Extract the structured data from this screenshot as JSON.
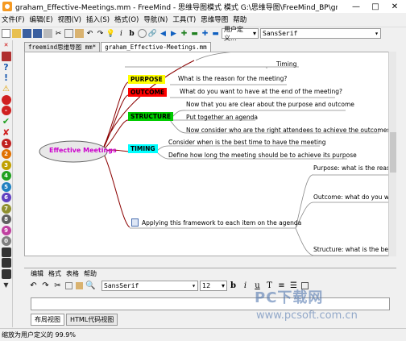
{
  "window": {
    "title": "graham_Effective-Meetings.mm - FreeMind - 思维导图模式 模式 G:\\思维导图\\FreeMind_BP\\graha...",
    "min_glyph": "—",
    "max_glyph": "□",
    "close_glyph": "✕"
  },
  "menu": [
    "文件(F)",
    "编辑(E)",
    "视图(V)",
    "插入(S)",
    "格式(O)",
    "导航(N)",
    "工具(T)",
    "思维导图",
    "帮助"
  ],
  "toolbar": {
    "zoom_value": "用户定义...",
    "font_value": "SansSerif"
  },
  "tabs": [
    "freemind思维导图 mm*",
    "graham_Effective-Meetings.mm"
  ],
  "mindmap": {
    "root": "Effective Meetings",
    "top_child": "Timing",
    "purpose": {
      "label": "PURPOSE",
      "text": "What is the reason for the meeting?"
    },
    "outcome": {
      "label": "OUTCOME",
      "text": "What do you want to have at the end of the meeting?"
    },
    "structure": {
      "label": "STRUCTURE",
      "items": [
        "Now that you are clear about the purpose and outcome",
        "Put together an agenda",
        "Now consider who are the right attendees to achieve the outcomes"
      ]
    },
    "timing": {
      "label": "TIMING",
      "items": [
        "Consider when is the best time to have the meeting",
        "Define how long the meeting should be to achieve its purpose"
      ]
    },
    "framework": "Applying this framework to each item on the agenda",
    "right_nodes": [
      "Purpose: what is the reaso",
      "Outcome: what do you wa",
      "Structure: what is the best"
    ]
  },
  "editor": {
    "menu": [
      "编辑",
      "格式",
      "表格",
      "帮助"
    ],
    "font": "SansSerif",
    "size": "12",
    "tabs": [
      "布局视图",
      "HTML代码视图"
    ]
  },
  "status": "缩放为用户定义的 99.9%",
  "watermark": {
    "line1": "PC下载网",
    "line2": "www.pcsoft.com.cn"
  },
  "colors": {
    "purpose": "#ffff00",
    "outcome": "#ff0000",
    "structure": "#00cc00",
    "timing": "#00ffff",
    "root_text": "#cc00cc",
    "edge": "#8b0000"
  }
}
